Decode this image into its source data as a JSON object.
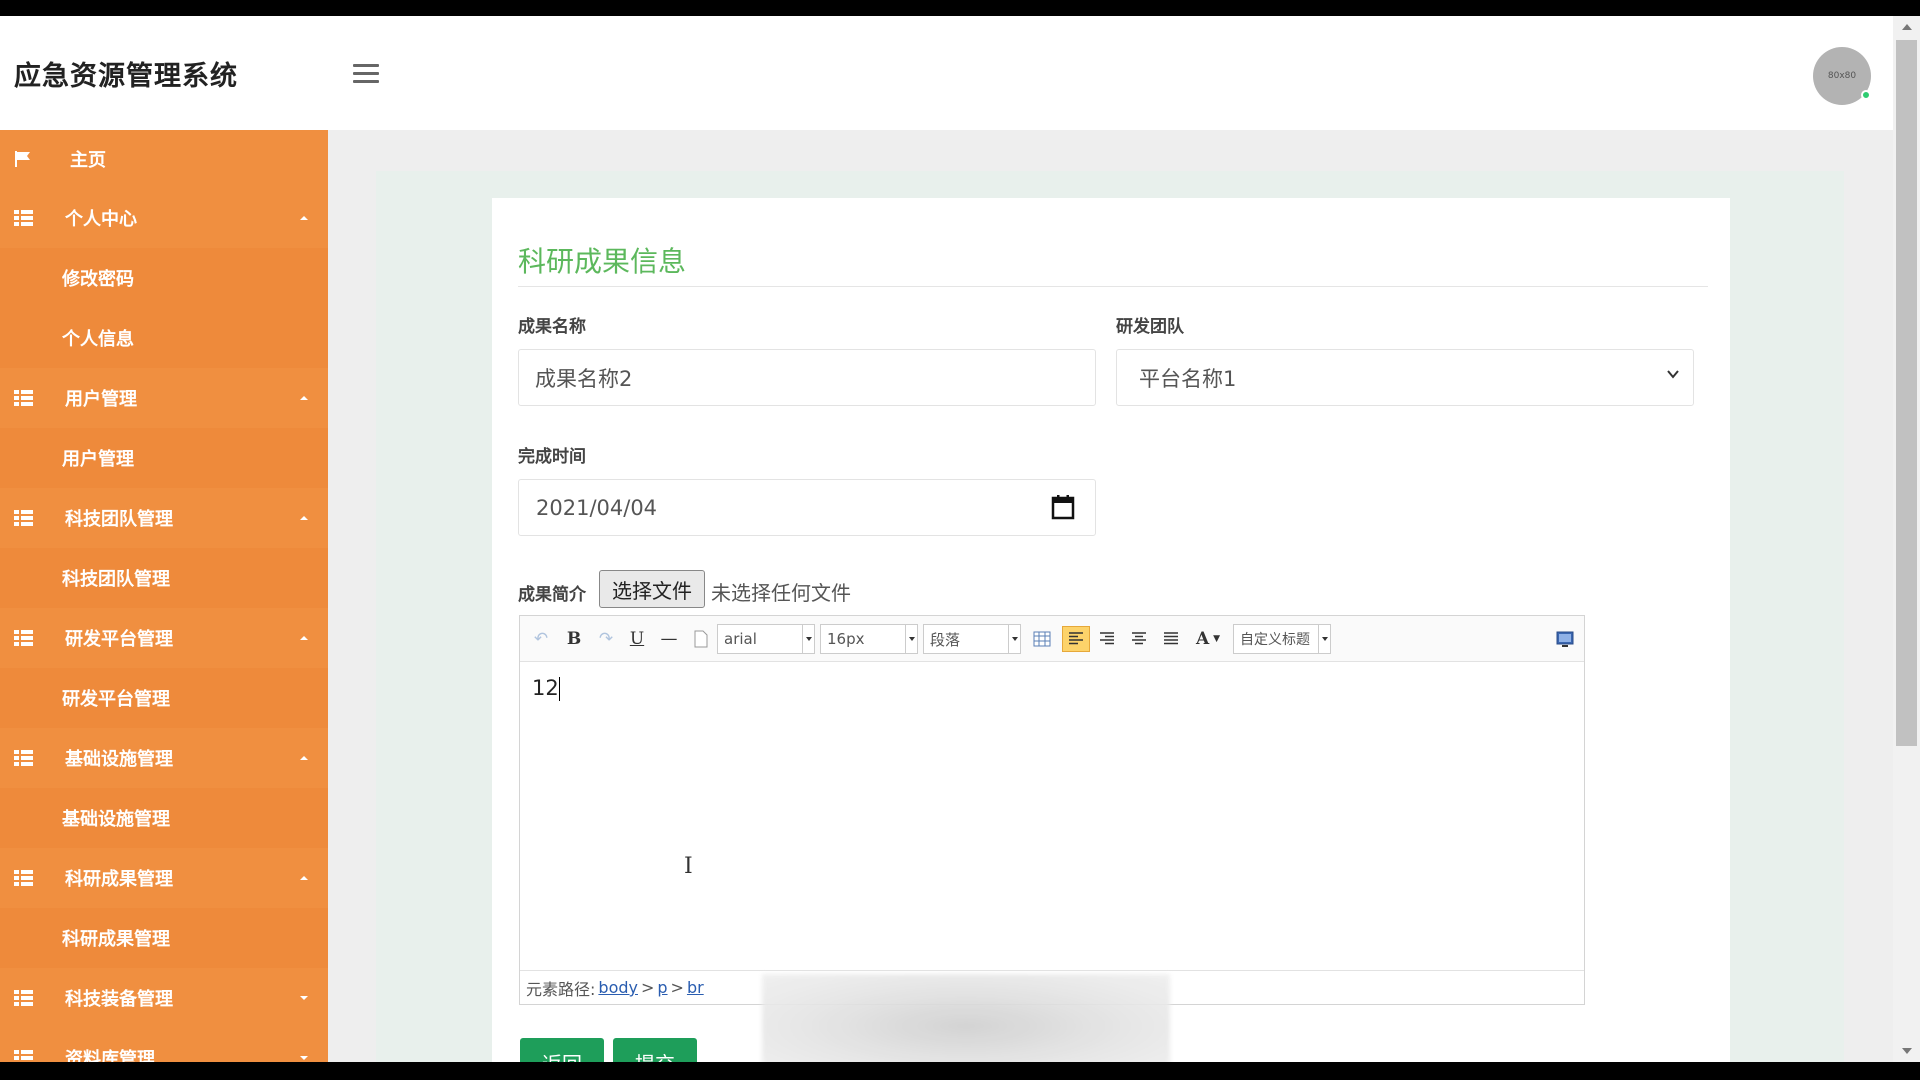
{
  "header": {
    "title": "应急资源管理系统",
    "avatar_text": "80x80"
  },
  "sidebar": {
    "home": "主页",
    "groups": [
      {
        "label": "个人中心",
        "expanded": true,
        "children": [
          "修改密码",
          "个人信息"
        ]
      },
      {
        "label": "用户管理",
        "expanded": true,
        "children": [
          "用户管理"
        ]
      },
      {
        "label": "科技团队管理",
        "expanded": true,
        "children": [
          "科技团队管理"
        ]
      },
      {
        "label": "研发平台管理",
        "expanded": true,
        "children": [
          "研发平台管理"
        ]
      },
      {
        "label": "基础设施管理",
        "expanded": true,
        "children": [
          "基础设施管理"
        ]
      },
      {
        "label": "科研成果管理",
        "expanded": true,
        "children": [
          "科研成果管理"
        ]
      },
      {
        "label": "科技装备管理",
        "expanded": false,
        "children": []
      },
      {
        "label": "资料库管理",
        "expanded": false,
        "children": []
      }
    ]
  },
  "form": {
    "title": "科研成果信息",
    "name_label": "成果名称",
    "name_value": "成果名称2",
    "team_label": "研发团队",
    "team_value": "平台名称1",
    "date_label": "完成时间",
    "date_value": "2021/04/04",
    "intro_label": "成果简介",
    "file_button": "选择文件",
    "file_status": "未选择任何文件"
  },
  "editor": {
    "font_family": "arial",
    "font_size": "16px",
    "paragraph": "段落",
    "custom_title": "自定义标题",
    "content": "12",
    "path_label": "元素路径:",
    "path": [
      "body",
      "p",
      "br"
    ]
  },
  "buttons": {
    "back": "返回",
    "submit": "提交"
  },
  "colors": {
    "sidebar": "#ee8a3b",
    "accent_green": "#5cb85c",
    "button_green": "#1e9e5a"
  }
}
